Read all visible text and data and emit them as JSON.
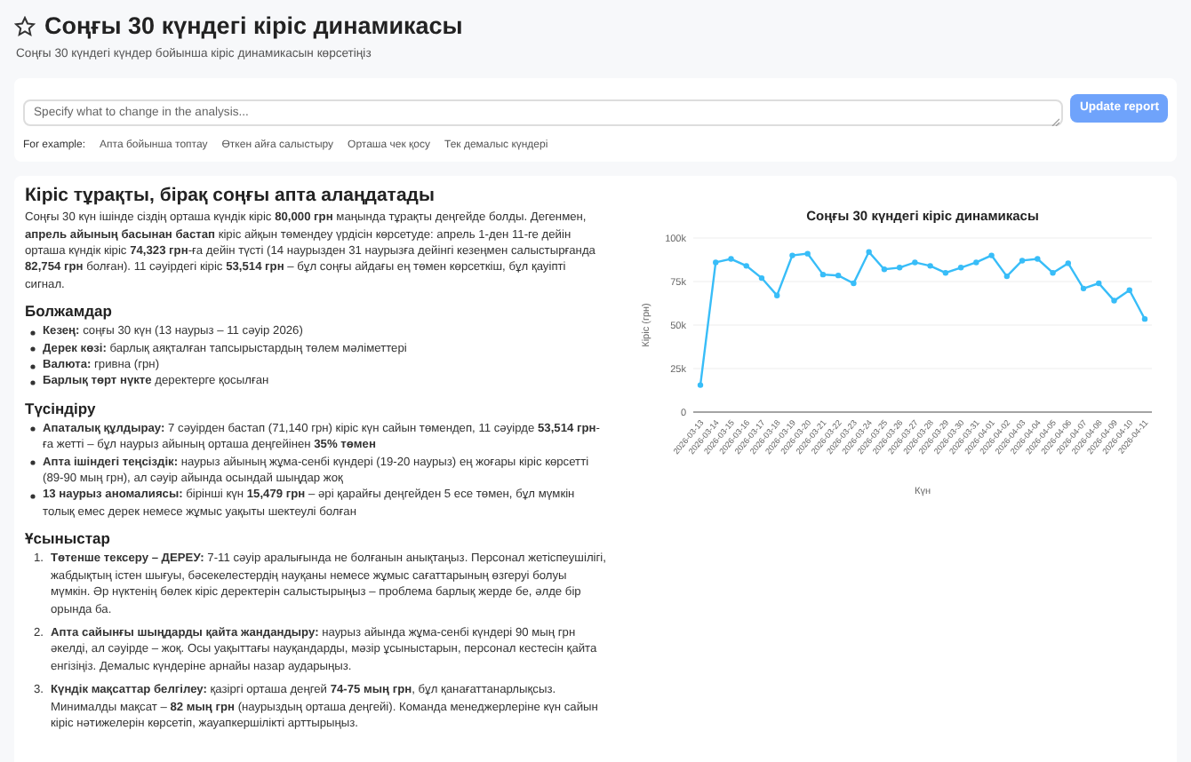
{
  "header": {
    "title": "Соңғы 30 күндегі кіріс динамикасы",
    "subtitle": "Соңғы 30 күндегі күндер бойынша кіріс динамикасын көрсетіңіз"
  },
  "prompt": {
    "placeholder": "Specify what to change in the analysis...",
    "button": "Update report",
    "examples_label": "For example:",
    "examples": [
      "Апта бойынша топтау",
      "Өткен айға салыстыру",
      "Орташа чек қосу",
      "Тек демалыс күндері"
    ]
  },
  "report": {
    "heading": "Кіріс тұрақты, бірақ соңғы апта алаңдатады",
    "summary": "Соңғы 30 күн ішінде сіздің орташа күндік кіріс **80,000 грн** маңында тұрақты деңгейде болды. Дегенмен, **апрель айының басынан бастап** кіріс айқын төмендеу үрдісін көрсетуде: апрель 1-ден 11-ге дейін орташа күндік кіріс **74,323 грн**-ға дейін түсті (14 наурызден 31 наурызға дейінгі кезеңмен салыстырғанда **82,754 грн** болған). 11 сәуірдегі кіріс **53,514 грн** – бұл соңғы айдағы ең төмен көрсеткіш, бұл қауіпті сигнал.",
    "sections": [
      {
        "title": "Болжамдар",
        "kind": "bullets",
        "items": [
          "**Кезең:** соңғы 30 күн (13 наурыз – 11 сәуір 2026)",
          "**Дерек көзі:** барлық аяқталған тапсырыстардың төлем мәліметтері",
          "**Валюта:** гривна (грн)",
          "**Барлық төрт нүкте** деректерге қосылған"
        ]
      },
      {
        "title": "Түсіндіру",
        "kind": "bullets",
        "items": [
          "**Апаталық құлдырау:** 7 сәуірден бастап (71,140 грн) кіріс күн сайын төмендеп, 11 сәуірде **53,514 грн**-ға жетті – бұл наурыз айының орташа деңгейінен **35% төмен**",
          "**Апта ішіндегі теңсіздік:** наурыз айының жұма-сенбі күндері (19-20 наурыз) ең жоғары кіріс көрсетті (89-90 мың грн), ал сәуір айында осындай шыңдар жоқ",
          "**13 наурыз аномалиясы:** бірінші күн **15,479 грн** – әрі қарайғы деңгейден 5 есе төмен, бұл мүмкін толық емес дерек немесе жұмыс уақыты шектеулі болған"
        ]
      },
      {
        "title": "Ұсыныстар",
        "kind": "numbered",
        "items": [
          {
            "number": "1.",
            "text": "**Төтенше тексеру – ДЕРЕУ:** 7-11 сәуір аралығында не болғанын анықтаңыз. Персонал жетіспеушілігі, жабдықтың істен шығуы, бәсекелестердің науқаны немесе жұмыс сағаттарының өзгеруі болуы мүмкін. Әр нүктенің бөлек кіріс деректерін салыстырыңыз – проблема барлық жерде бе, әлде бір орында ба."
          },
          {
            "number": "2.",
            "text": "**Апта сайынғы шыңдарды қайта жандандыру:** наурыз айында жұма-сенбі күндері 90 мың грн әкелді, ал сәуірде – жоқ. Осы уақыттағы науқандарды, мәзір ұсыныстарын, персонал кестесін қайта енгізіңіз. Демалыс күндеріне арнайы назар аударыңыз."
          },
          {
            "number": "3.",
            "text": "**Күндік мақсаттар белгілеу:** қазіргі орташа деңгей **74-75 мың грн**, бұл қанағаттанарлықсыз. Минималды мақсат – **82 мың грн** (наурыздың орташа деңгейі). Команда менеджерлеріне күн сайын кіріс нәтижелерін көрсетіп, жауапкершілікті арттырыңыз."
          }
        ]
      }
    ]
  },
  "chart_data": {
    "type": "line",
    "title": "Соңғы 30 күндегі кіріс динамикасы",
    "xlabel": "Күн",
    "ylabel": "Кіріс (грн)",
    "categories": [
      "2026-03-13",
      "2026-03-14",
      "2026-03-15",
      "2026-03-16",
      "2026-03-17",
      "2026-03-18",
      "2026-03-19",
      "2026-03-20",
      "2026-03-21",
      "2026-03-22",
      "2026-03-23",
      "2026-03-24",
      "2026-03-25",
      "2026-03-26",
      "2026-03-27",
      "2026-03-28",
      "2026-03-29",
      "2026-03-30",
      "2026-03-31",
      "2026-04-01",
      "2026-04-02",
      "2026-04-03",
      "2026-04-04",
      "2026-04-05",
      "2026-04-06",
      "2026-04-07",
      "2026-04-08",
      "2026-04-09",
      "2026-04-10",
      "2026-04-11"
    ],
    "series": [
      {
        "color": "#38bdf8",
        "marker": "circle",
        "values": [
          15500,
          86000,
          88000,
          84000,
          77000,
          67000,
          90000,
          91000,
          79000,
          78500,
          74000,
          92000,
          82000,
          83000,
          86000,
          84000,
          80000,
          83000,
          86000,
          90000,
          78000,
          87000,
          88000,
          80000,
          85500,
          71000,
          74000,
          64000,
          70000,
          53500
        ]
      }
    ],
    "grid": true,
    "ylim": [
      0,
      100000
    ],
    "yticks": [
      {
        "value": 0,
        "label": "0"
      },
      {
        "value": 25000,
        "label": "25k"
      },
      {
        "value": 50000,
        "label": "50k"
      },
      {
        "value": 75000,
        "label": "75k"
      },
      {
        "value": 100000,
        "label": "100k"
      }
    ]
  }
}
